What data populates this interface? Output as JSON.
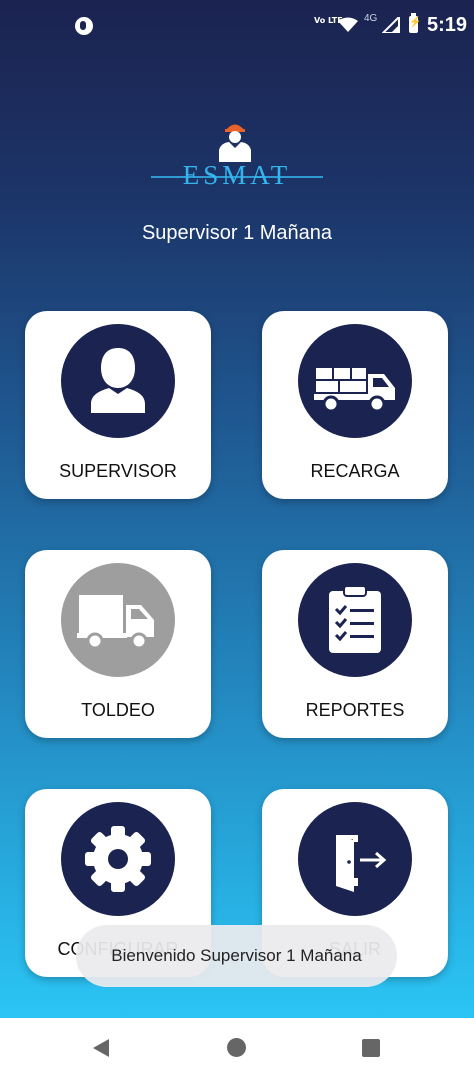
{
  "status_bar": {
    "time": "5:19",
    "network": "4G",
    "volte": "Vo LTE"
  },
  "logo": {
    "brand": "ESMAT"
  },
  "user": {
    "name": "Supervisor 1 Mañana"
  },
  "tiles": [
    {
      "label": "SUPERVISOR",
      "icon": "person-icon"
    },
    {
      "label": "RECARGA",
      "icon": "loaded-truck-icon"
    },
    {
      "label": "TOLDEO",
      "icon": "truck-icon"
    },
    {
      "label": "REPORTES",
      "icon": "clipboard-checklist-icon"
    },
    {
      "label": "CONFIGURAR",
      "icon": "gear-icon"
    },
    {
      "label": "SALIR",
      "icon": "exit-door-icon"
    }
  ],
  "toast": {
    "message": "Bienvenido Supervisor 1 Mañana"
  },
  "colors": {
    "tile_circle": "#1b2350",
    "tile_circle_disabled": "#9e9e9e",
    "accent": "#35b5ee",
    "tile_bg": "#ffffff"
  }
}
